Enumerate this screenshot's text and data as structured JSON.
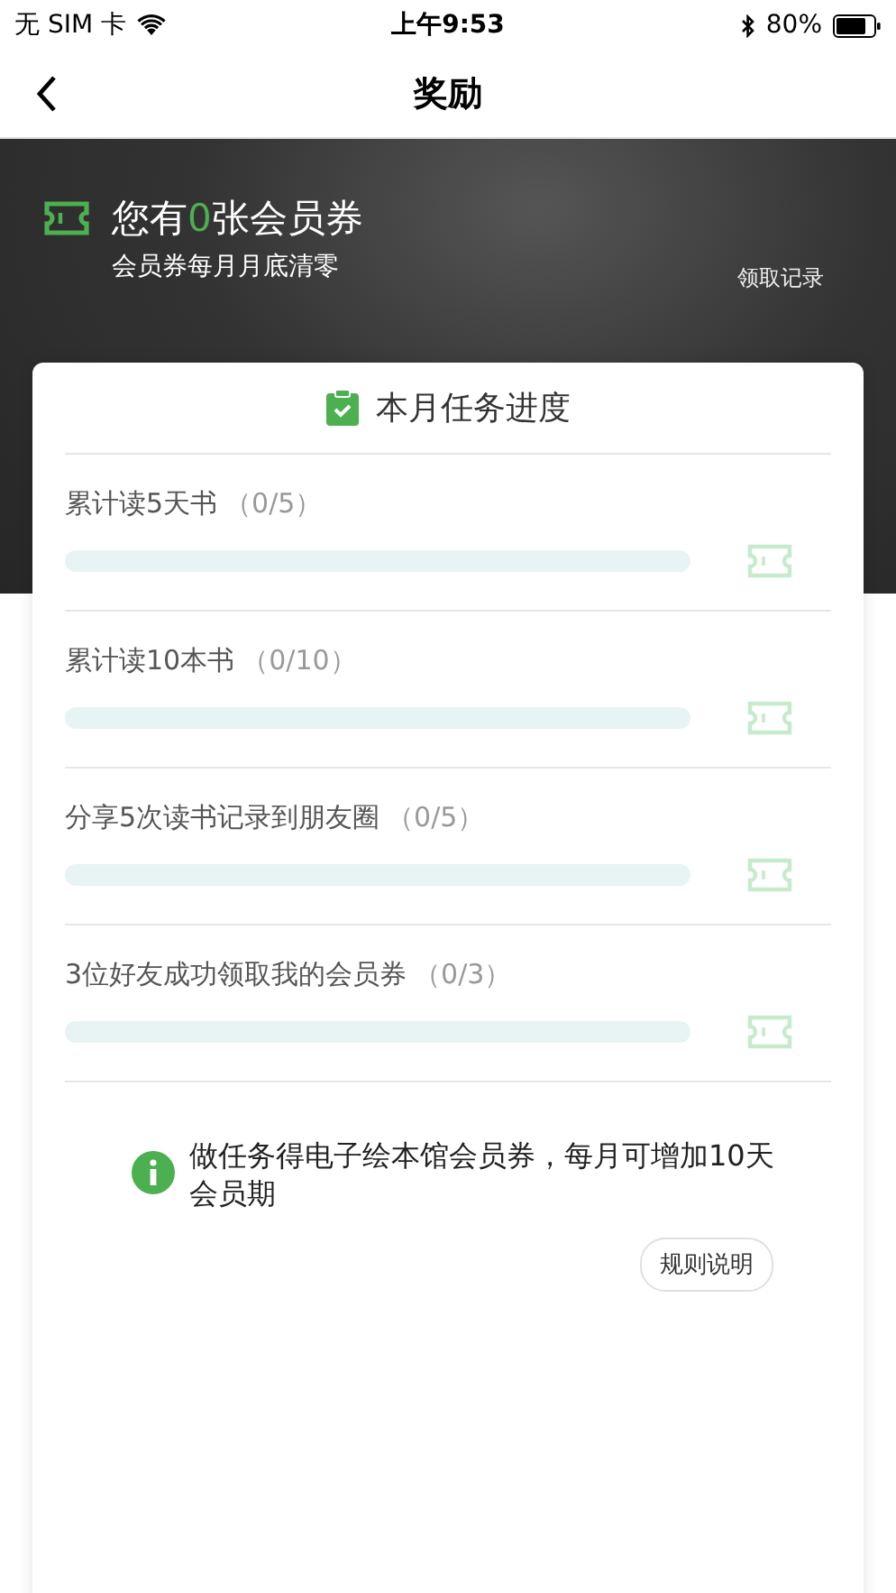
{
  "status_bar": {
    "carrier": "无 SIM 卡",
    "time": "上午9:53",
    "battery": "80%"
  },
  "nav": {
    "title": "奖励"
  },
  "header": {
    "coupon_prefix": "您有",
    "coupon_count": "0",
    "coupon_suffix": "张会员券",
    "subtitle": "会员券每月月底清零",
    "record_link": "领取记录"
  },
  "card": {
    "title": "本月任务进度",
    "tasks": [
      {
        "name": "累计读5天书",
        "progress": "（0/5）",
        "level": 0
      },
      {
        "name": "累计读10本书",
        "progress": "（0/10）",
        "level": 0
      },
      {
        "name": "分享5次读书记录到朋友圈",
        "progress": "（0/5）",
        "level": 0
      },
      {
        "name": "3位好友成功领取我的会员券",
        "progress": "（0/3）",
        "level": 0
      }
    ],
    "notice": "做任务得电子绘本馆会员券，每月可增加10天会员期",
    "rules_button": "规则说明"
  }
}
